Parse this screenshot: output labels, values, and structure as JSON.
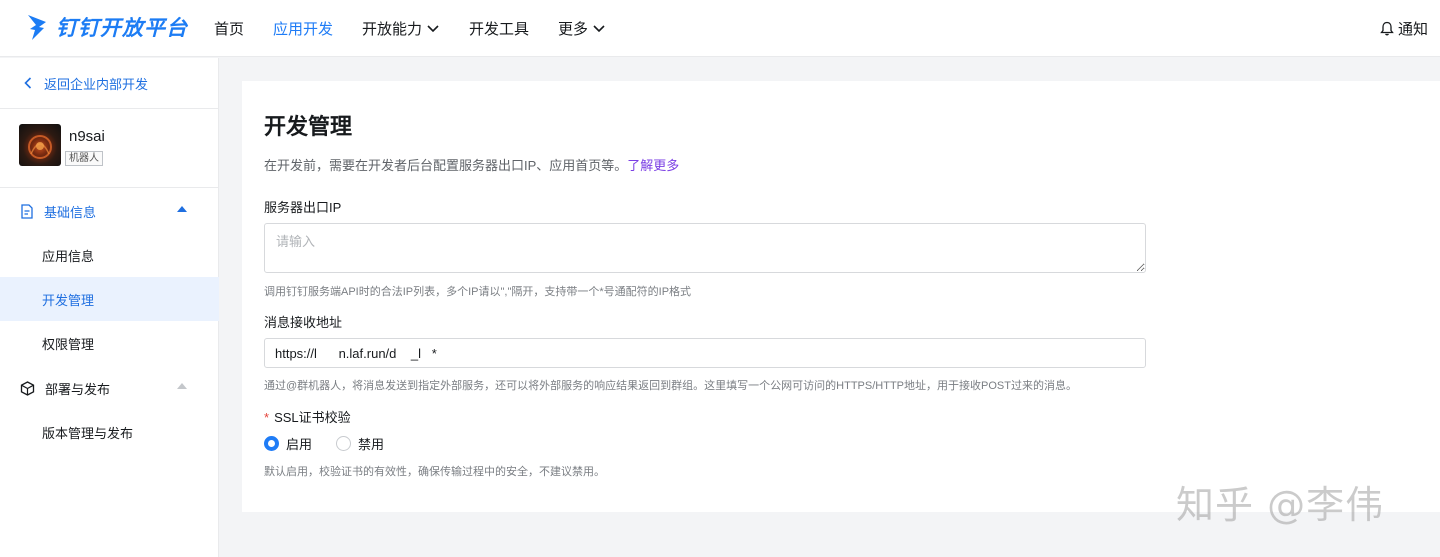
{
  "brand": {
    "name": "钉钉开放平台",
    "color": "#1c7cf4"
  },
  "nav": {
    "items": [
      {
        "label": "首页",
        "active": false,
        "dropdown": false
      },
      {
        "label": "应用开发",
        "active": true,
        "dropdown": false
      },
      {
        "label": "开放能力",
        "active": false,
        "dropdown": true
      },
      {
        "label": "开发工具",
        "active": false,
        "dropdown": false
      },
      {
        "label": "更多",
        "active": false,
        "dropdown": true
      }
    ],
    "notify_label": "通知",
    "notify_icon": "bell-icon"
  },
  "sidebar": {
    "back_label": "返回企业内部开发",
    "app": {
      "name": "n9sai",
      "tag": "机器人"
    },
    "groups": [
      {
        "label": "基础信息",
        "icon": "document-icon",
        "expanded": true,
        "items": [
          "应用信息",
          "开发管理",
          "权限管理"
        ]
      },
      {
        "label": "部署与发布",
        "icon": "cube-icon",
        "expanded": true,
        "items": [
          "版本管理与发布"
        ]
      }
    ],
    "selected_item": "开发管理"
  },
  "main": {
    "title": "开发管理",
    "description": "在开发前，需要在开发者后台配置服务器出口IP、应用首页等。",
    "learn_more": "了解更多",
    "server_ip": {
      "label": "服务器出口IP",
      "placeholder": "请输入",
      "value": "",
      "hint": "调用钉钉服务端API时的合法IP列表，多个IP请以\",\"隔开，支持带一个*号通配符的IP格式"
    },
    "message_url": {
      "label": "消息接收地址",
      "value": "https://l      n.laf.run/d    _l   *",
      "hint": "通过@群机器人，将消息发送到指定外部服务，还可以将外部服务的响应结果返回到群组。这里填写一个公网可访问的HTTPS/HTTP地址，用于接收POST过来的消息。"
    },
    "ssl": {
      "required_mark": "*",
      "label": "SSL证书校验",
      "options": [
        "启用",
        "禁用"
      ],
      "selected": "启用",
      "hint": "默认启用，校验证书的有效性，确保传输过程中的安全，不建议禁用。"
    }
  },
  "watermark": "知乎 @李伟",
  "colors": {
    "accent": "#1f7cf6",
    "link": "#7b3fe4",
    "required": "#e5443b"
  }
}
